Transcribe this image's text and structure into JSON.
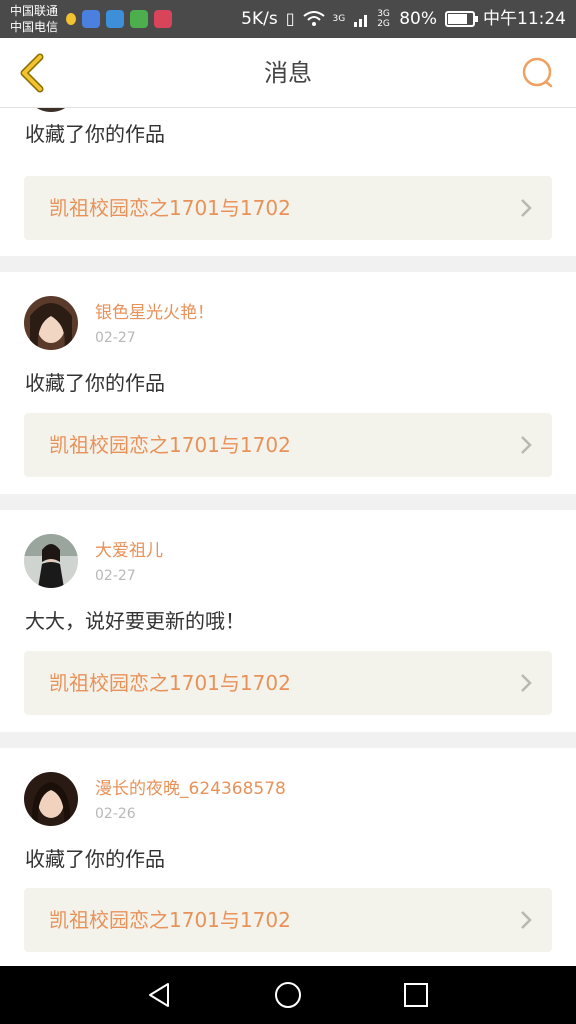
{
  "status_bar": {
    "carrier_line1": "中国联通",
    "carrier_line2": "中国电信",
    "net_speed": "5K/s",
    "signal1": "3G",
    "signal2": "3G 2G",
    "battery": "80%",
    "battery_level": 0.8,
    "time": "中午11:24",
    "app_icon_colors": [
      "#f2c230",
      "#4b7fe0",
      "#3d8fd9",
      "#4cae4c",
      "#d8455a"
    ]
  },
  "header": {
    "title": "消息",
    "back_icon": "chevron-left-icon",
    "search_icon": "search-icon",
    "accent": "#e8925a"
  },
  "messages": [
    {
      "text": "收藏了你的作品",
      "work": "凯祖校园恋之1701与1702"
    },
    {
      "user": "银色星光火艳！",
      "date": "02-27",
      "text": "收藏了你的作品",
      "work": "凯祖校园恋之1701与1702"
    },
    {
      "user": "大爱祖儿",
      "date": "02-27",
      "text": "大大，说好要更新的哦！",
      "work": "凯祖校园恋之1701与1702"
    },
    {
      "user": "漫长的夜晚_624368578",
      "date": "02-26",
      "text": "收藏了你的作品",
      "work": "凯祖校园恋之1701与1702"
    }
  ],
  "system_nav": {
    "back": "triangle-back-icon",
    "home": "circle-home-icon",
    "recents": "square-recents-icon"
  }
}
